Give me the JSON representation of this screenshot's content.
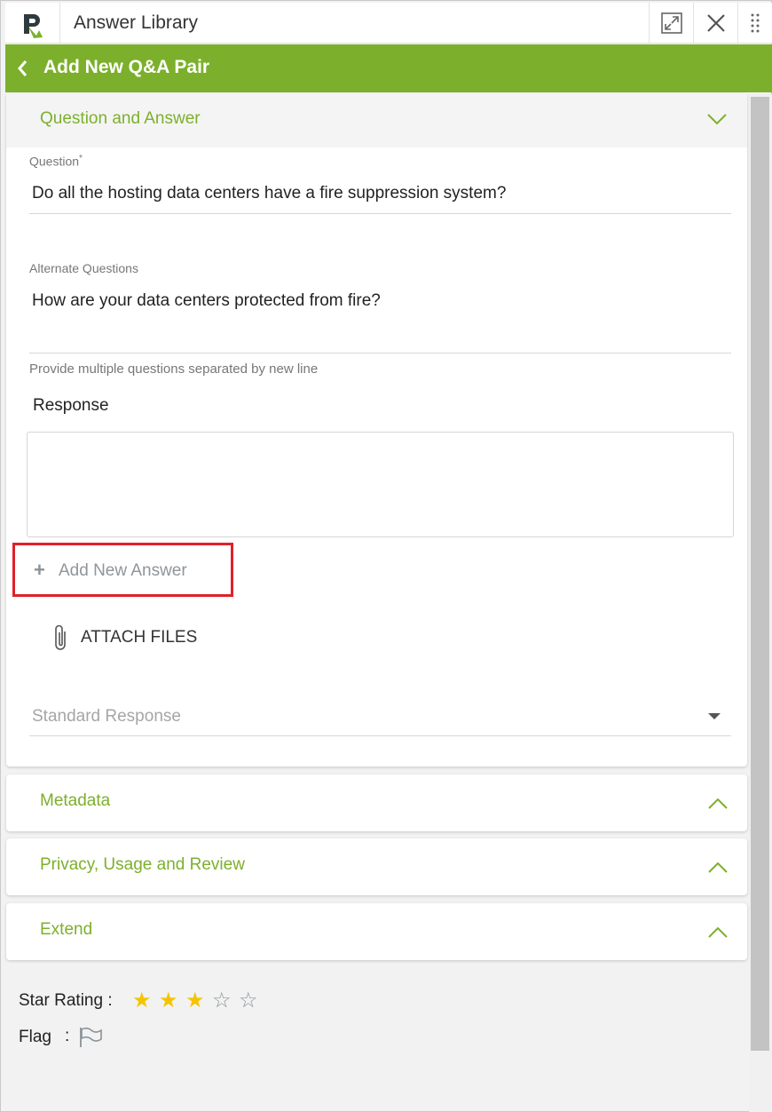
{
  "window": {
    "app_title": "Answer Library",
    "logo_icon": "rfpio-logo-icon",
    "expand_icon": "expand-icon",
    "close_icon": "close-icon",
    "drag_icon": "drag-handle-icon"
  },
  "header": {
    "back_icon": "chevron-left-icon",
    "title": "Add New Q&A Pair",
    "color": "#7cb02c"
  },
  "sections": {
    "qa": {
      "title": "Question and Answer",
      "expanded": true,
      "question": {
        "label": "Question",
        "required_mark": "*",
        "value": "Do all the hosting data  centers have a fire suppression system?"
      },
      "alternate": {
        "label": "Alternate Questions",
        "value": "How are your data centers protected from fire?",
        "hint": "Provide multiple questions separated by new line"
      },
      "response": {
        "label": "Response",
        "value": ""
      },
      "add_answer": {
        "label": "Add New Answer",
        "highlight_color": "#e0202a"
      },
      "attach": {
        "label": "ATTACH FILES"
      },
      "standard_response": {
        "placeholder": "Standard Response"
      }
    },
    "metadata": {
      "title": "Metadata",
      "expanded": false
    },
    "privacy": {
      "title": "Privacy, Usage and Review",
      "expanded": false
    },
    "extend": {
      "title": "Extend",
      "expanded": false
    }
  },
  "footer": {
    "star_label": "Star Rating :",
    "rating": 3,
    "max_rating": 5,
    "flag_label": "Flag",
    "flag_separator": ":",
    "flag_icon": "flag-outline-icon"
  }
}
